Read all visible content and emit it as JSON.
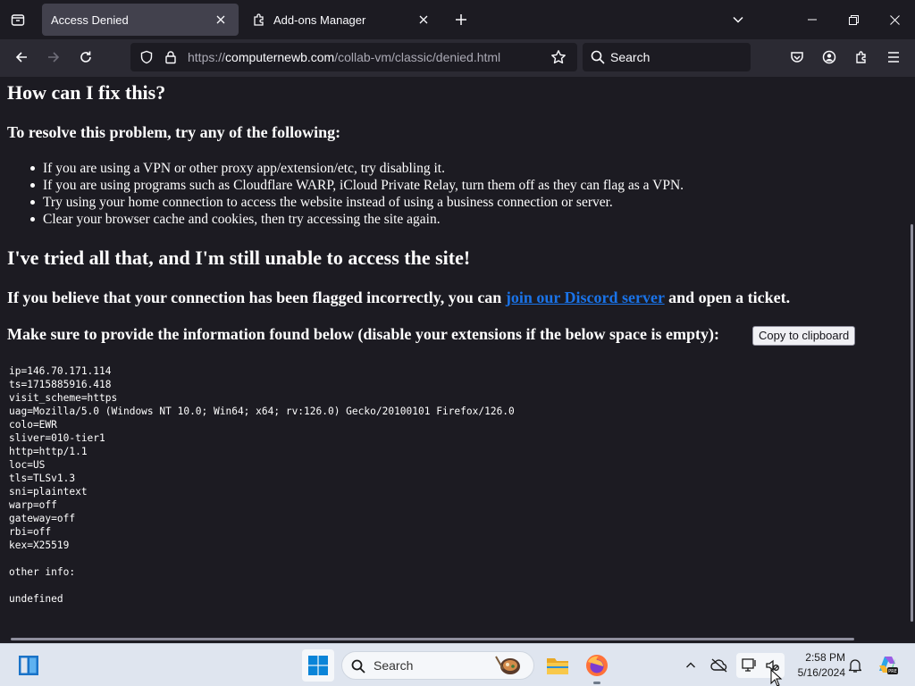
{
  "tabs": [
    {
      "title": "Access Denied",
      "active": true
    },
    {
      "title": "Add-ons Manager",
      "active": false
    }
  ],
  "navbar": {
    "url_prefix": "https://",
    "url_host": "computernewb.com",
    "url_path": "/collab-vm/classic/denied.html",
    "search_label": "Search"
  },
  "page": {
    "heading_fix": "How can I fix this?",
    "resolve_heading": "To resolve this problem, try any of the following:",
    "tips": [
      "If you are using a VPN or other proxy app/extension/etc, try disabling it.",
      "If you are using programs such as Cloudflare WARP, iCloud Private Relay, turn them off as they can flag as a VPN.",
      "Try using your home connection to access the website instead of using a business connection or server.",
      "Clear your browser cache and cookies, then try accessing the site again."
    ],
    "heading_tried": "I've tried all that, and I'm still unable to access the site!",
    "flagged_before": "If you believe that your connection has been flagged incorrectly, you can ",
    "discord_link": "join our Discord server",
    "flagged_after": " and open a ticket.",
    "provide_info": "Make sure to provide the information found below (disable your extensions if the below space is empty):",
    "copy_button": "Copy to clipboard",
    "trace_info": "ip=146.70.171.114\nts=1715885916.418\nvisit_scheme=https\nuag=Mozilla/5.0 (Windows NT 10.0; Win64; x64; rv:126.0) Gecko/20100101 Firefox/126.0\ncolo=EWR\nsliver=010-tier1\nhttp=http/1.1\nloc=US\ntls=TLSv1.3\nsni=plaintext\nwarp=off\ngateway=off\nrbi=off\nkex=X25519\n\nother info:\n\nundefined"
  },
  "taskbar": {
    "search_label": "Search",
    "time": "2:58 PM",
    "date": "5/16/2024"
  },
  "colors": {
    "page_bg": "#1c1b22",
    "toolbar_bg": "#2b2a33",
    "link": "#1a73e8",
    "taskbar_bg": "#dfe5ef"
  }
}
